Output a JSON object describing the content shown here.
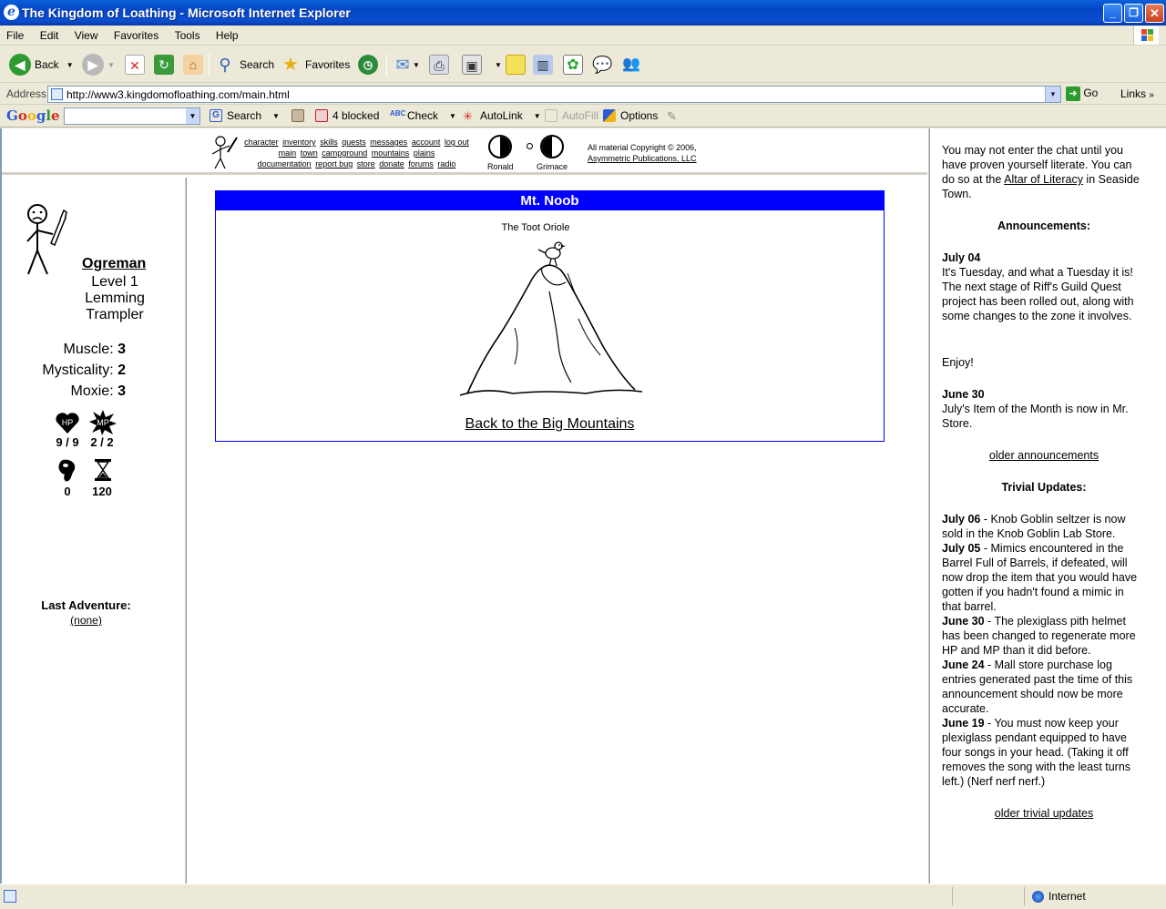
{
  "window": {
    "title": "The Kingdom of Loathing - Microsoft Internet Explorer"
  },
  "menu": [
    "File",
    "Edit",
    "View",
    "Favorites",
    "Tools",
    "Help"
  ],
  "toolbar": {
    "back": "Back",
    "search": "Search",
    "favorites": "Favorites"
  },
  "address": {
    "label": "Address",
    "url": "http://www3.kingdomofloathing.com/main.html",
    "go": "Go",
    "links": "Links"
  },
  "googlebar": {
    "logo": "Google",
    "search": "Search",
    "blocked": "4 blocked",
    "check": "Check",
    "autolink": "AutoLink",
    "autofill": "AutoFill",
    "options": "Options"
  },
  "topnav": {
    "row1": [
      "character",
      "inventory",
      "skills",
      "quests",
      "messages",
      "account",
      "log out"
    ],
    "row2": [
      "main",
      "town",
      "campground",
      "mountains",
      "plains"
    ],
    "row3": [
      "documentation",
      "report bug",
      "store",
      "donate",
      "forums",
      "radio"
    ],
    "moon1": "Ronald",
    "moon2": "Grimace",
    "copyright1": "All material Copyright © 2006,",
    "copyright2": "Asymmetric Publications, LLC"
  },
  "character": {
    "name": "Ogreman",
    "level": "Level 1",
    "title1": "Lemming",
    "title2": "Trampler",
    "muscle_label": "Muscle:",
    "muscle": "3",
    "myst_label": "Mysticality:",
    "myst": "2",
    "moxie_label": "Moxie:",
    "moxie": "3",
    "hp_icon": "HP",
    "hp": "9 / 9",
    "mp_icon": "MP",
    "mp": "2 / 2",
    "meat": "0",
    "adventures": "120",
    "last_adventure_label": "Last Adventure:",
    "last_adventure": "(none)"
  },
  "main": {
    "header": "Mt. Noob",
    "caption": "The Toot Oriole",
    "back_link": "Back to the Big Mountains"
  },
  "chat": {
    "intro_before": "You may not enter the chat until you have proven yourself literate. You can do so at the ",
    "intro_link": "Altar of Literacy",
    "intro_after": " in Seaside Town.",
    "announcements_title": "Announcements:",
    "ann1_date": "July 04",
    "ann1_text": "It's Tuesday, and what a Tuesday it is! The next stage of Riff's Guild Quest project has been rolled out, along with some changes to the zone it involves.",
    "ann1_enjoy": "Enjoy!",
    "ann2_date": "June 30",
    "ann2_text": "July's Item of the Month is now in Mr. Store.",
    "older_announcements": "older announcements",
    "trivial_title": "Trivial Updates:",
    "updates": [
      {
        "date": "July 06",
        "text": " - Knob Goblin seltzer is now sold in the Knob Goblin Lab Store."
      },
      {
        "date": "July 05",
        "text": " - Mimics encountered in the Barrel Full of Barrels, if defeated, will now drop the item that you would have gotten if you hadn't found a mimic in that barrel."
      },
      {
        "date": "June 30",
        "text": " - The plexiglass pith helmet has been changed to regenerate more HP and MP than it did before."
      },
      {
        "date": "June 24",
        "text": " - Mall store purchase log entries generated past the time of this announcement should now be more accurate."
      },
      {
        "date": "June 19",
        "text": " - You must now keep your plexiglass pendant equipped to have four songs in your head. (Taking it off removes the song with the least turns left.) (Nerf nerf nerf.)"
      }
    ],
    "older_trivial": "older trivial updates"
  },
  "status": {
    "zone": "Internet"
  }
}
